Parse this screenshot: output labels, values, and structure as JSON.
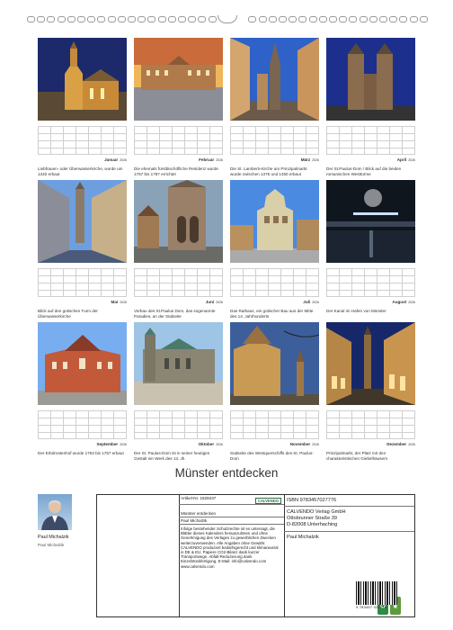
{
  "months": [
    {
      "label": "Januar",
      "year": "2026",
      "caption": "Liebfrauen- oder Überwasserkirche, wurde um 1340 erbaut",
      "scene": "church-night"
    },
    {
      "label": "Februar",
      "year": "2026",
      "caption": "Die ehemals fürstbischöfliche Residenz wurde 1767 bis 1787 errichtet",
      "scene": "palace-sunset"
    },
    {
      "label": "März",
      "year": "2026",
      "caption": "Die St. Lamberti-Kirche am Prinzipalmarkt wurde zwischen 1375 und 1450 erbaut",
      "scene": "street-spire"
    },
    {
      "label": "April",
      "year": "2026",
      "caption": "Der St.Paulus-Dom / Blick auf die beiden romanischen Westtürme",
      "scene": "twin-towers"
    },
    {
      "label": "Mai",
      "year": "2026",
      "caption": "Blick auf den gotischen Turm der Überwasserkirche",
      "scene": "lane"
    },
    {
      "label": "Juni",
      "year": "2026",
      "caption": "Vorbau des St.Paulus Dom, das sogenannte Paradies, an der Südseite",
      "scene": "cathedral-facade"
    },
    {
      "label": "Juli",
      "year": "2026",
      "caption": "Das Rathaus, ein gotischer Bau aus der Mitte des 14. Jahrhunderts",
      "scene": "townhall"
    },
    {
      "label": "August",
      "year": "2026",
      "caption": "Der Kanal im Hafen von Münster",
      "scene": "harbour-night"
    },
    {
      "label": "September",
      "year": "2026",
      "caption": "Der Erbdrostenhof wurde 1753 bis 1757 erbaut",
      "scene": "baroque"
    },
    {
      "label": "Oktober",
      "year": "2026",
      "caption": "Der St. Paulus-Dom ist in seiner heutigen Gestalt ein Werk des 13. Jh.",
      "scene": "dome-day"
    },
    {
      "label": "November",
      "year": "2026",
      "caption": "Südseite des Westquerschiffs des St. Paulus-Dom",
      "scene": "gothic-dusk"
    },
    {
      "label": "Dezember",
      "year": "2026",
      "caption": "Prinzipalmarkt, der Platz mit den charakteristischen Giebelhäusern",
      "scene": "arcade-night"
    }
  ],
  "title": "Münster entdecken",
  "author": {
    "name": "Paul Michalzik",
    "sub": "Paul Michalzik"
  },
  "info": {
    "article": "Artikel-Nr. 1528437",
    "logo": "CALVENDO",
    "cal_title": "Münster entdecken",
    "cal_author": "Paul Michalzik",
    "legal": "Infolge bestehender Schutzrechte ist es untersagt, die Blätter dieses Kalenders herauszulösen und ohne Genehmigung des Verlages zu gewerblichen Zwecken weiterzuverwenden. Alle Angaben ohne Gewähr. CALVENDO produziert bedarfsgerecht und klimaneutral in DE & EU. Papiere CO2-Bilanz dank kurzer Transportwege. Abfall-Reduzierung dank Einzelstückfertigung. E-Mail: info@calvendo.com www.calvendo.com",
    "isbn": "ISBN 9783457027776",
    "publisher": [
      "CALVENDO Verlag GmbH",
      "Ottobrunner Straße 39",
      "D-82008 Unterhaching"
    ],
    "author2": "Paul Michalzik",
    "barcode_number": "9 783457 027776"
  }
}
